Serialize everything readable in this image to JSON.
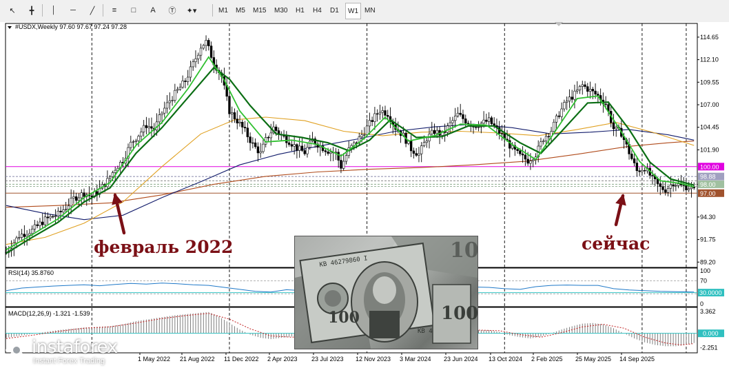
{
  "toolbar": {
    "tools": [
      "cursor-icon",
      "crosshair-icon",
      "vertical-line-icon",
      "horizontal-line-icon",
      "trendline-icon",
      "fibonacci-icon",
      "channel-icon",
      "text-icon",
      "text-label-icon",
      "shapes-dropdown-icon"
    ],
    "timeframes": [
      "M1",
      "M5",
      "M15",
      "M30",
      "H1",
      "H4",
      "D1",
      "W1",
      "MN"
    ],
    "active_timeframe": "W1"
  },
  "header": {
    "symbol_line": "#USDX,Weekly  97.60 97.67 97.24 97.28"
  },
  "annotations": {
    "left_label": "февраль 2022",
    "right_label": "сейчас",
    "arrow_color": "#7b1016"
  },
  "logo": {
    "name": "instaforex",
    "tagline": "Instant Forex Trading"
  },
  "chart_data": {
    "type": "candlestick",
    "symbol": "#USDX",
    "timeframe": "Weekly",
    "ohlc": {
      "open": 97.6,
      "high": 97.67,
      "low": 97.24,
      "close": 97.28
    },
    "price_axis_ticks": [
      114.65,
      112.1,
      109.55,
      107.0,
      104.45,
      101.9,
      98.0,
      94.3,
      91.75,
      89.2
    ],
    "price_range": [
      88.6,
      116.2
    ],
    "price_labels": [
      {
        "value": 100.0,
        "text": "100.00",
        "color": "#e000e0"
      },
      {
        "value": 98.88,
        "text": "98.88",
        "color": "#a0a0c0"
      },
      {
        "value": 98.0,
        "text": "98.00",
        "color": "#a0c0a0"
      },
      {
        "value": 97.0,
        "text": "97.00",
        "color": "#a0522d"
      }
    ],
    "time_axis_labels": [
      "1 May 2022",
      "21 Aug 2022",
      "11 Dec 2022",
      "2 Apr 2023",
      "23 Jul 2023",
      "12 Nov 2023",
      "3 Mar 2024",
      "23 Jun 2024",
      "13 Oct 2024",
      "2 Feb 2025",
      "25 May 2025",
      "14 Sep 2025"
    ],
    "price_series": [
      [
        0,
        90.3
      ],
      [
        5,
        92.2
      ],
      [
        10,
        92.8
      ],
      [
        15,
        94.0
      ],
      [
        20,
        94.6
      ],
      [
        23,
        95.4
      ],
      [
        26,
        96.4
      ],
      [
        30,
        97.0
      ],
      [
        33,
        96.6
      ],
      [
        36,
        97.4
      ],
      [
        39,
        98.4
      ],
      [
        42,
        99.8
      ],
      [
        45,
        100.7
      ],
      [
        48,
        102.6
      ],
      [
        51,
        103.6
      ],
      [
        54,
        104.7
      ],
      [
        57,
        104.2
      ],
      [
        60,
        106.1
      ],
      [
        63,
        107.5
      ],
      [
        66,
        108.6
      ],
      [
        69,
        109.7
      ],
      [
        72,
        111.6
      ],
      [
        75,
        113.6
      ],
      [
        77,
        114.1
      ],
      [
        80,
        111.8
      ],
      [
        83,
        110.2
      ],
      [
        86,
        106.3
      ],
      [
        89,
        105.2
      ],
      [
        92,
        104.0
      ],
      [
        95,
        102.5
      ],
      [
        98,
        101.5
      ],
      [
        100,
        103.0
      ],
      [
        103,
        104.4
      ],
      [
        106,
        103.5
      ],
      [
        109,
        102.9
      ],
      [
        112,
        102.1
      ],
      [
        115,
        101.6
      ],
      [
        118,
        103.0
      ],
      [
        121,
        102.3
      ],
      [
        124,
        101.8
      ],
      [
        127,
        101.5
      ],
      [
        129,
        100.0
      ],
      [
        132,
        101.9
      ],
      [
        135,
        102.8
      ],
      [
        138,
        104.0
      ],
      [
        141,
        105.3
      ],
      [
        144,
        106.4
      ],
      [
        147,
        106.0
      ],
      [
        150,
        104.4
      ],
      [
        153,
        103.5
      ],
      [
        156,
        102.0
      ],
      [
        159,
        101.4
      ],
      [
        162,
        103.2
      ],
      [
        165,
        104.0
      ],
      [
        168,
        103.6
      ],
      [
        171,
        104.8
      ],
      [
        174,
        105.9
      ],
      [
        177,
        105.2
      ],
      [
        180,
        104.6
      ],
      [
        183,
        104.9
      ],
      [
        186,
        105.2
      ],
      [
        189,
        104.2
      ],
      [
        192,
        103.2
      ],
      [
        195,
        102.0
      ],
      [
        198,
        101.2
      ],
      [
        201,
        100.7
      ],
      [
        204,
        101.4
      ],
      [
        207,
        103.2
      ],
      [
        210,
        104.1
      ],
      [
        213,
        106.0
      ],
      [
        216,
        107.4
      ],
      [
        219,
        108.2
      ],
      [
        222,
        109.2
      ],
      [
        225,
        108.6
      ],
      [
        228,
        108.0
      ],
      [
        231,
        107.1
      ],
      [
        234,
        104.3
      ],
      [
        237,
        103.8
      ],
      [
        240,
        101.6
      ],
      [
        243,
        99.5
      ],
      [
        246,
        99.9
      ],
      [
        249,
        98.6
      ],
      [
        252,
        97.6
      ],
      [
        254,
        97.4
      ],
      [
        257,
        98.2
      ],
      [
        260,
        97.8
      ],
      [
        263,
        97.7
      ],
      [
        265,
        97.28
      ]
    ],
    "ema_fast_green": [
      [
        0,
        90.6
      ],
      [
        10,
        92.3
      ],
      [
        20,
        94.1
      ],
      [
        30,
        96.5
      ],
      [
        40,
        98.2
      ],
      [
        50,
        102.4
      ],
      [
        60,
        105.0
      ],
      [
        70,
        108.8
      ],
      [
        78,
        112.4
      ],
      [
        84,
        109.8
      ],
      [
        90,
        106.3
      ],
      [
        100,
        102.8
      ],
      [
        110,
        103.0
      ],
      [
        120,
        102.5
      ],
      [
        129,
        101.2
      ],
      [
        138,
        103.2
      ],
      [
        146,
        105.6
      ],
      [
        155,
        102.9
      ],
      [
        165,
        103.5
      ],
      [
        175,
        104.8
      ],
      [
        185,
        104.7
      ],
      [
        195,
        102.5
      ],
      [
        204,
        100.8
      ],
      [
        212,
        104.2
      ],
      [
        220,
        107.7
      ],
      [
        228,
        108.0
      ],
      [
        236,
        104.4
      ],
      [
        244,
        100.6
      ],
      [
        252,
        98.4
      ],
      [
        260,
        98.1
      ],
      [
        265,
        97.7
      ]
    ],
    "ema_slow_darkgreen": [
      [
        0,
        90.2
      ],
      [
        10,
        92.0
      ],
      [
        20,
        93.7
      ],
      [
        30,
        96.0
      ],
      [
        40,
        97.6
      ],
      [
        50,
        101.5
      ],
      [
        60,
        104.4
      ],
      [
        70,
        107.8
      ],
      [
        80,
        111.2
      ],
      [
        86,
        109.9
      ],
      [
        94,
        106.9
      ],
      [
        104,
        103.7
      ],
      [
        114,
        103.3
      ],
      [
        124,
        102.7
      ],
      [
        132,
        101.8
      ],
      [
        140,
        103.0
      ],
      [
        148,
        105.3
      ],
      [
        158,
        103.3
      ],
      [
        168,
        103.4
      ],
      [
        178,
        104.6
      ],
      [
        188,
        104.6
      ],
      [
        198,
        102.7
      ],
      [
        206,
        101.5
      ],
      [
        214,
        104.0
      ],
      [
        224,
        107.2
      ],
      [
        232,
        107.3
      ],
      [
        240,
        104.2
      ],
      [
        248,
        100.5
      ],
      [
        256,
        98.6
      ],
      [
        265,
        97.9
      ]
    ],
    "ma_navy": [
      [
        0,
        95.6
      ],
      [
        15,
        94.7
      ],
      [
        30,
        94.0
      ],
      [
        45,
        94.5
      ],
      [
        60,
        96.5
      ],
      [
        75,
        98.3
      ],
      [
        90,
        100.2
      ],
      [
        105,
        101.4
      ],
      [
        120,
        102.3
      ],
      [
        135,
        103.1
      ],
      [
        150,
        104.0
      ],
      [
        165,
        104.5
      ],
      [
        180,
        104.8
      ],
      [
        195,
        104.4
      ],
      [
        210,
        103.7
      ],
      [
        225,
        103.9
      ],
      [
        240,
        104.2
      ],
      [
        255,
        103.6
      ],
      [
        265,
        103.0
      ]
    ],
    "ma_orange": [
      [
        0,
        91.2
      ],
      [
        15,
        92.0
      ],
      [
        30,
        93.6
      ],
      [
        45,
        96.0
      ],
      [
        60,
        100.0
      ],
      [
        75,
        103.7
      ],
      [
        88,
        105.3
      ],
      [
        100,
        105.6
      ],
      [
        115,
        105.2
      ],
      [
        130,
        104.0
      ],
      [
        145,
        103.5
      ],
      [
        160,
        103.9
      ],
      [
        175,
        104.0
      ],
      [
        190,
        103.8
      ],
      [
        205,
        103.5
      ],
      [
        220,
        104.2
      ],
      [
        235,
        105.0
      ],
      [
        250,
        103.8
      ],
      [
        265,
        102.4
      ]
    ],
    "ma_brown": [
      [
        0,
        95.4
      ],
      [
        20,
        95.6
      ],
      [
        40,
        95.9
      ],
      [
        60,
        96.8
      ],
      [
        80,
        98.0
      ],
      [
        100,
        98.9
      ],
      [
        120,
        99.4
      ],
      [
        140,
        99.7
      ],
      [
        160,
        99.9
      ],
      [
        180,
        100.2
      ],
      [
        200,
        100.6
      ],
      [
        220,
        101.4
      ],
      [
        240,
        102.3
      ],
      [
        255,
        102.7
      ],
      [
        265,
        102.9
      ]
    ],
    "horizontal_levels": [
      100.0,
      98.88,
      98.0,
      97.0
    ],
    "vertical_separators_index": [
      33,
      86,
      139,
      192,
      245,
      262
    ],
    "rsi": {
      "label": "RSI(14) 35.8760",
      "period": 14,
      "value": 35.876,
      "levels": [
        70,
        30
      ],
      "axis_ticks": [
        100,
        70,
        30,
        0
      ],
      "marker": "30.0000",
      "range": [
        0,
        100
      ],
      "series": [
        [
          0,
          40
        ],
        [
          6,
          48
        ],
        [
          12,
          51
        ],
        [
          18,
          54
        ],
        [
          24,
          56
        ],
        [
          30,
          58
        ],
        [
          36,
          55
        ],
        [
          42,
          59
        ],
        [
          48,
          62
        ],
        [
          54,
          60
        ],
        [
          60,
          63
        ],
        [
          66,
          61
        ],
        [
          72,
          58
        ],
        [
          78,
          56
        ],
        [
          84,
          50
        ],
        [
          90,
          44
        ],
        [
          96,
          38
        ],
        [
          102,
          36
        ],
        [
          108,
          43
        ],
        [
          114,
          40
        ],
        [
          120,
          38
        ],
        [
          126,
          41
        ],
        [
          132,
          46
        ],
        [
          138,
          48
        ],
        [
          144,
          49
        ],
        [
          150,
          47
        ],
        [
          156,
          44
        ],
        [
          162,
          50
        ],
        [
          168,
          52
        ],
        [
          174,
          53
        ],
        [
          180,
          51
        ],
        [
          186,
          50
        ],
        [
          192,
          46
        ],
        [
          198,
          44
        ],
        [
          204,
          52
        ],
        [
          210,
          56
        ],
        [
          216,
          57
        ],
        [
          222,
          56
        ],
        [
          228,
          56
        ],
        [
          234,
          46
        ],
        [
          240,
          42
        ],
        [
          246,
          40
        ],
        [
          252,
          38
        ],
        [
          258,
          37
        ],
        [
          265,
          35.9
        ]
      ]
    },
    "macd": {
      "label": "MACD(12,26,9) -1.321 -1.539",
      "params": [
        12,
        26,
        9
      ],
      "main": -1.321,
      "signal": -1.539,
      "axis_ticks": [
        3.362,
        0.0,
        -2.251
      ],
      "marker": "0.000",
      "range": [
        -2.6,
        3.6
      ],
      "histogram": [
        [
          0,
          -0.7
        ],
        [
          5,
          -0.4
        ],
        [
          10,
          -0.1
        ],
        [
          15,
          0.2
        ],
        [
          20,
          0.5
        ],
        [
          25,
          0.7
        ],
        [
          30,
          0.9
        ],
        [
          35,
          1.0
        ],
        [
          40,
          1.1
        ],
        [
          45,
          1.4
        ],
        [
          50,
          1.9
        ],
        [
          55,
          2.2
        ],
        [
          60,
          2.5
        ],
        [
          65,
          2.8
        ],
        [
          70,
          3.0
        ],
        [
          75,
          3.2
        ],
        [
          78,
          3.3
        ],
        [
          82,
          2.6
        ],
        [
          86,
          1.6
        ],
        [
          90,
          0.6
        ],
        [
          94,
          -0.2
        ],
        [
          98,
          -0.7
        ],
        [
          102,
          -0.9
        ],
        [
          106,
          -0.7
        ],
        [
          110,
          -0.5
        ],
        [
          114,
          -0.4
        ],
        [
          118,
          -0.3
        ],
        [
          122,
          -0.4
        ],
        [
          126,
          -0.6
        ],
        [
          130,
          -0.5
        ],
        [
          134,
          -0.1
        ],
        [
          138,
          0.3
        ],
        [
          142,
          0.8
        ],
        [
          146,
          1.0
        ],
        [
          150,
          0.6
        ],
        [
          154,
          0.0
        ],
        [
          158,
          -0.4
        ],
        [
          162,
          -0.2
        ],
        [
          166,
          0.1
        ],
        [
          170,
          0.3
        ],
        [
          174,
          0.5
        ],
        [
          178,
          0.6
        ],
        [
          182,
          0.5
        ],
        [
          186,
          0.5
        ],
        [
          190,
          0.2
        ],
        [
          194,
          -0.3
        ],
        [
          198,
          -0.6
        ],
        [
          202,
          -0.8
        ],
        [
          206,
          -0.5
        ],
        [
          210,
          0.0
        ],
        [
          214,
          0.6
        ],
        [
          218,
          1.1
        ],
        [
          222,
          1.5
        ],
        [
          226,
          1.6
        ],
        [
          230,
          1.4
        ],
        [
          234,
          0.8
        ],
        [
          238,
          0.0
        ],
        [
          242,
          -0.8
        ],
        [
          246,
          -1.4
        ],
        [
          250,
          -1.8
        ],
        [
          254,
          -2.0
        ],
        [
          258,
          -2.0
        ],
        [
          262,
          -1.8
        ],
        [
          265,
          -1.5
        ]
      ],
      "signal_series": [
        [
          0,
          -0.8
        ],
        [
          10,
          -0.3
        ],
        [
          20,
          0.3
        ],
        [
          30,
          0.8
        ],
        [
          40,
          1.0
        ],
        [
          50,
          1.6
        ],
        [
          60,
          2.3
        ],
        [
          70,
          2.8
        ],
        [
          78,
          3.1
        ],
        [
          86,
          2.2
        ],
        [
          94,
          0.7
        ],
        [
          102,
          -0.4
        ],
        [
          110,
          -0.6
        ],
        [
          118,
          -0.4
        ],
        [
          126,
          -0.5
        ],
        [
          134,
          -0.4
        ],
        [
          142,
          0.3
        ],
        [
          150,
          0.6
        ],
        [
          158,
          0.0
        ],
        [
          166,
          -0.1
        ],
        [
          174,
          0.3
        ],
        [
          182,
          0.5
        ],
        [
          190,
          0.4
        ],
        [
          198,
          -0.2
        ],
        [
          206,
          -0.6
        ],
        [
          214,
          0.1
        ],
        [
          222,
          1.0
        ],
        [
          230,
          1.4
        ],
        [
          238,
          0.8
        ],
        [
          246,
          -0.6
        ],
        [
          254,
          -1.5
        ],
        [
          260,
          -1.8
        ],
        [
          265,
          -1.6
        ]
      ]
    }
  }
}
